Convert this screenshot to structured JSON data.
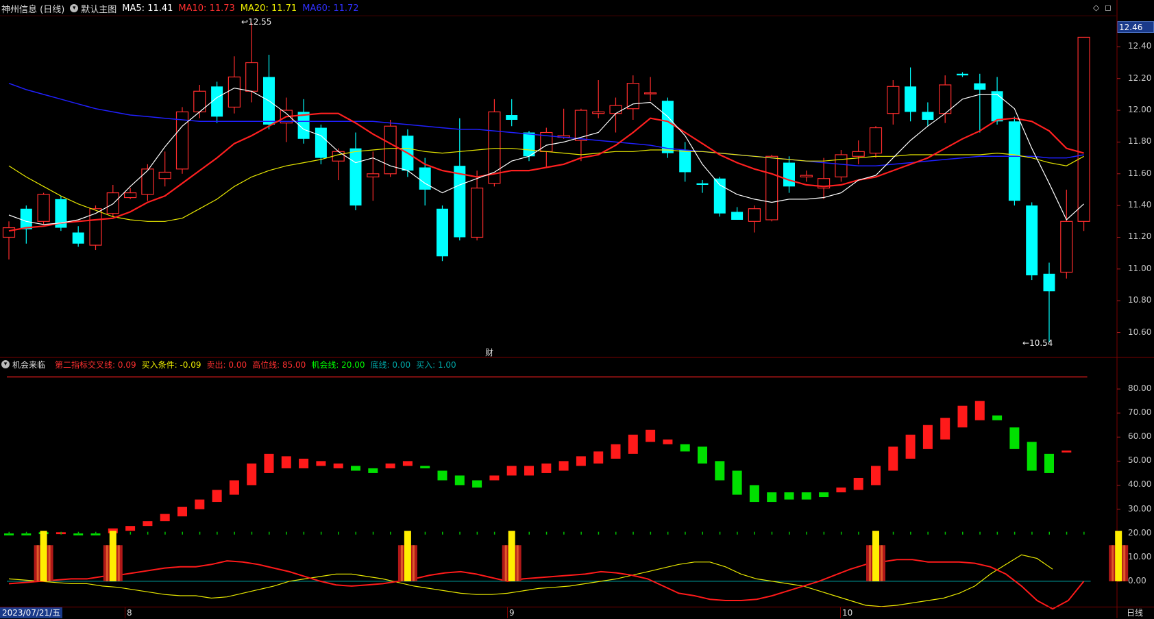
{
  "main_header": {
    "stock_label": "神州信息 (日线)",
    "main_chart_label": "默认主图",
    "ma5_label": "MA5: 11.41",
    "ma10_label": "MA10: 11.73",
    "ma20_label": "MA20: 11.71",
    "ma60_label": "MA60: 11.72",
    "colors": {
      "ma5": "#ffffff",
      "ma10": "#ff2020",
      "ma20": "#e8e800",
      "ma60": "#2020ff",
      "up": "#ff2d2d",
      "down": "#00ffff"
    }
  },
  "indicator_header": {
    "name": "机会来临",
    "cross_line": "第二指标交叉线: 0.09",
    "buy_condition": "买入条件: -0.09",
    "sell": "卖出: 0.00",
    "high_line": "高位线: 85.00",
    "chance_line": "机会线: 20.00",
    "bottom_line": "底线: 0.00",
    "buy": "买入: 1.00"
  },
  "price_axis": {
    "current_price": "12.46",
    "ticks": [
      "12.40",
      "12.20",
      "12.00",
      "11.80",
      "11.60",
      "11.40",
      "11.20",
      "11.00",
      "10.80",
      "10.60"
    ]
  },
  "indicator_axis": {
    "ticks": [
      "80.00",
      "70.00",
      "60.00",
      "50.00",
      "40.00",
      "30.00",
      "20.00",
      "10.00",
      "0.00"
    ]
  },
  "annotations": {
    "high_marker": "12.55",
    "low_marker": "10.54",
    "finance_icon": "财"
  },
  "date_axis": {
    "start_date": "2023/07/21/五",
    "month_labels": [
      "8",
      "9",
      "10"
    ],
    "period_label": "日线"
  },
  "chart_data": {
    "type": "candlestick",
    "ylim": [
      10.46,
      12.6
    ],
    "candles": [
      {
        "o": 11.2,
        "c": 11.26,
        "h": 11.3,
        "l": 11.06
      },
      {
        "o": 11.38,
        "c": 11.25,
        "h": 11.4,
        "l": 11.16
      },
      {
        "o": 11.3,
        "c": 11.47,
        "h": 11.48,
        "l": 11.28
      },
      {
        "o": 11.44,
        "c": 11.26,
        "h": 11.46,
        "l": 11.24
      },
      {
        "o": 11.23,
        "c": 11.16,
        "h": 11.27,
        "l": 11.14
      },
      {
        "o": 11.15,
        "c": 11.38,
        "h": 11.4,
        "l": 11.12
      },
      {
        "o": 11.35,
        "c": 11.48,
        "h": 11.53,
        "l": 11.33
      },
      {
        "o": 11.45,
        "c": 11.48,
        "h": 11.51,
        "l": 11.44
      },
      {
        "o": 11.47,
        "c": 11.63,
        "h": 11.66,
        "l": 11.43
      },
      {
        "o": 11.57,
        "c": 11.61,
        "h": 11.74,
        "l": 11.52
      },
      {
        "o": 11.63,
        "c": 11.99,
        "h": 12.02,
        "l": 11.6
      },
      {
        "o": 11.99,
        "c": 12.12,
        "h": 12.16,
        "l": 11.95
      },
      {
        "o": 12.15,
        "c": 11.96,
        "h": 12.18,
        "l": 11.92
      },
      {
        "o": 12.02,
        "c": 12.21,
        "h": 12.34,
        "l": 11.98
      },
      {
        "o": 12.12,
        "c": 12.3,
        "h": 12.55,
        "l": 12.05
      },
      {
        "o": 12.21,
        "c": 11.91,
        "h": 12.35,
        "l": 11.88
      },
      {
        "o": 11.92,
        "c": 12.0,
        "h": 12.08,
        "l": 11.8
      },
      {
        "o": 11.99,
        "c": 11.82,
        "h": 12.07,
        "l": 11.79
      },
      {
        "o": 11.89,
        "c": 11.7,
        "h": 11.91,
        "l": 11.66
      },
      {
        "o": 11.68,
        "c": 11.74,
        "h": 11.76,
        "l": 11.56
      },
      {
        "o": 11.76,
        "c": 11.4,
        "h": 11.86,
        "l": 11.37
      },
      {
        "o": 11.58,
        "c": 11.6,
        "h": 11.74,
        "l": 11.43
      },
      {
        "o": 11.6,
        "c": 11.9,
        "h": 11.94,
        "l": 11.58
      },
      {
        "o": 11.84,
        "c": 11.62,
        "h": 11.88,
        "l": 11.58
      },
      {
        "o": 11.64,
        "c": 11.5,
        "h": 11.7,
        "l": 11.4
      },
      {
        "o": 11.38,
        "c": 11.08,
        "h": 11.4,
        "l": 11.05
      },
      {
        "o": 11.65,
        "c": 11.2,
        "h": 11.95,
        "l": 11.18
      },
      {
        "o": 11.2,
        "c": 11.51,
        "h": 11.62,
        "l": 11.18
      },
      {
        "o": 11.54,
        "c": 11.99,
        "h": 12.07,
        "l": 11.52
      },
      {
        "o": 11.97,
        "c": 11.94,
        "h": 12.07,
        "l": 11.9
      },
      {
        "o": 11.86,
        "c": 11.71,
        "h": 11.87,
        "l": 11.68
      },
      {
        "o": 11.74,
        "c": 11.86,
        "h": 11.89,
        "l": 11.64
      },
      {
        "o": 11.83,
        "c": 11.84,
        "h": 12.01,
        "l": 11.82
      },
      {
        "o": 11.81,
        "c": 12.0,
        "h": 12.01,
        "l": 11.68
      },
      {
        "o": 11.98,
        "c": 11.99,
        "h": 12.19,
        "l": 11.95
      },
      {
        "o": 11.98,
        "c": 12.03,
        "h": 12.08,
        "l": 11.86
      },
      {
        "o": 12.01,
        "c": 12.17,
        "h": 12.22,
        "l": 11.94
      },
      {
        "o": 12.11,
        "c": 12.11,
        "h": 12.21,
        "l": 12.06
      },
      {
        "o": 12.06,
        "c": 11.73,
        "h": 12.08,
        "l": 11.7
      },
      {
        "o": 11.75,
        "c": 11.61,
        "h": 11.8,
        "l": 11.55
      },
      {
        "o": 11.54,
        "c": 11.53,
        "h": 11.56,
        "l": 11.48
      },
      {
        "o": 11.57,
        "c": 11.35,
        "h": 11.58,
        "l": 11.33
      },
      {
        "o": 11.36,
        "c": 11.31,
        "h": 11.39,
        "l": 11.31
      },
      {
        "o": 11.3,
        "c": 11.38,
        "h": 11.4,
        "l": 11.23
      },
      {
        "o": 11.31,
        "c": 11.71,
        "h": 11.72,
        "l": 11.3
      },
      {
        "o": 11.67,
        "c": 11.52,
        "h": 11.71,
        "l": 11.48
      },
      {
        "o": 11.58,
        "c": 11.59,
        "h": 11.62,
        "l": 11.55
      },
      {
        "o": 11.51,
        "c": 11.57,
        "h": 11.7,
        "l": 11.44
      },
      {
        "o": 11.58,
        "c": 11.72,
        "h": 11.75,
        "l": 11.55
      },
      {
        "o": 11.71,
        "c": 11.74,
        "h": 11.81,
        "l": 11.66
      },
      {
        "o": 11.73,
        "c": 11.89,
        "h": 11.9,
        "l": 11.7
      },
      {
        "o": 11.98,
        "c": 12.15,
        "h": 12.19,
        "l": 11.91
      },
      {
        "o": 12.15,
        "c": 11.99,
        "h": 12.27,
        "l": 11.93
      },
      {
        "o": 11.99,
        "c": 11.94,
        "h": 12.05,
        "l": 11.9
      },
      {
        "o": 11.98,
        "c": 12.16,
        "h": 12.22,
        "l": 11.92
      },
      {
        "o": 12.23,
        "c": 12.22,
        "h": 12.24,
        "l": 12.21
      },
      {
        "o": 12.17,
        "c": 12.13,
        "h": 12.23,
        "l": 11.86
      },
      {
        "o": 12.12,
        "c": 11.93,
        "h": 12.21,
        "l": 11.91
      },
      {
        "o": 11.93,
        "c": 11.43,
        "h": 11.96,
        "l": 11.4
      },
      {
        "o": 11.4,
        "c": 10.96,
        "h": 11.42,
        "l": 10.93
      },
      {
        "o": 10.97,
        "c": 10.86,
        "h": 11.04,
        "l": 10.54
      },
      {
        "o": 10.98,
        "c": 11.3,
        "h": 11.5,
        "l": 10.94
      },
      {
        "o": 11.3,
        "c": 12.46,
        "h": 12.46,
        "l": 11.24
      }
    ],
    "ma5": [
      11.34,
      11.3,
      11.28,
      11.29,
      11.31,
      11.35,
      11.41,
      11.52,
      11.62,
      11.77,
      11.9,
      11.99,
      12.08,
      12.14,
      12.12,
      12.06,
      11.98,
      11.88,
      11.84,
      11.74,
      11.67,
      11.7,
      11.65,
      11.62,
      11.54,
      11.48,
      11.53,
      11.57,
      11.61,
      11.68,
      11.71,
      11.78,
      11.8,
      11.83,
      11.86,
      11.98,
      12.04,
      12.05,
      11.96,
      11.84,
      11.66,
      11.53,
      11.47,
      11.44,
      11.42,
      11.44,
      11.44,
      11.45,
      11.48,
      11.56,
      11.59,
      11.7,
      11.81,
      11.9,
      11.98,
      12.07,
      12.1,
      12.1,
      12.01,
      11.76,
      11.54,
      11.31,
      11.41
    ],
    "ma10": [
      11.24,
      11.26,
      11.27,
      11.29,
      11.3,
      11.31,
      11.32,
      11.36,
      11.42,
      11.46,
      11.54,
      11.62,
      11.7,
      11.79,
      11.84,
      11.9,
      11.96,
      11.97,
      11.98,
      11.98,
      11.92,
      11.85,
      11.79,
      11.73,
      11.66,
      11.62,
      11.6,
      11.58,
      11.6,
      11.62,
      11.62,
      11.64,
      11.66,
      11.7,
      11.72,
      11.78,
      11.86,
      11.95,
      11.93,
      11.86,
      11.79,
      11.72,
      11.67,
      11.63,
      11.6,
      11.56,
      11.53,
      11.52,
      11.53,
      11.56,
      11.58,
      11.62,
      11.66,
      11.7,
      11.76,
      11.82,
      11.87,
      11.94,
      11.95,
      11.93,
      11.87,
      11.76,
      11.73
    ],
    "ma20": [
      11.65,
      11.58,
      11.52,
      11.46,
      11.41,
      11.37,
      11.33,
      11.31,
      11.3,
      11.3,
      11.32,
      11.38,
      11.44,
      11.52,
      11.58,
      11.62,
      11.65,
      11.67,
      11.69,
      11.72,
      11.74,
      11.75,
      11.76,
      11.76,
      11.74,
      11.73,
      11.74,
      11.75,
      11.76,
      11.76,
      11.75,
      11.74,
      11.73,
      11.72,
      11.73,
      11.74,
      11.74,
      11.75,
      11.75,
      11.74,
      11.74,
      11.73,
      11.72,
      11.71,
      11.7,
      11.69,
      11.68,
      11.68,
      11.69,
      11.7,
      11.71,
      11.71,
      11.72,
      11.72,
      11.72,
      11.72,
      11.72,
      11.73,
      11.72,
      11.7,
      11.67,
      11.65,
      11.71
    ],
    "ma60": [
      12.17,
      12.13,
      12.1,
      12.07,
      12.04,
      12.01,
      11.99,
      11.97,
      11.96,
      11.95,
      11.94,
      11.93,
      11.93,
      11.93,
      11.93,
      11.93,
      11.93,
      11.93,
      11.93,
      11.93,
      11.93,
      11.93,
      11.92,
      11.91,
      11.9,
      11.89,
      11.88,
      11.88,
      11.87,
      11.86,
      11.85,
      11.84,
      11.83,
      11.82,
      11.81,
      11.8,
      11.79,
      11.78,
      11.76,
      11.75,
      11.74,
      11.73,
      11.72,
      11.71,
      11.7,
      11.69,
      11.68,
      11.67,
      11.66,
      11.65,
      11.65,
      11.66,
      11.67,
      11.68,
      11.69,
      11.7,
      11.71,
      11.71,
      11.71,
      11.71,
      11.7,
      11.7,
      11.72
    ],
    "indicator": {
      "ylim": [
        -10,
        88
      ],
      "high_line": 85,
      "chance_line": 20,
      "bottom_line": 0,
      "bars": [
        {
          "v": 19.5,
          "c": "green"
        },
        {
          "v": 19.5,
          "c": "green"
        },
        {
          "v": 20,
          "c": "green"
        },
        {
          "v": 20,
          "c": "red"
        },
        {
          "v": 19.5,
          "c": "green"
        },
        {
          "v": 19.5,
          "c": "green"
        },
        {
          "v": 21,
          "c": "red"
        },
        {
          "v": 22,
          "c": "red"
        },
        {
          "v": 24,
          "c": "red"
        },
        {
          "v": 26,
          "c": "red"
        },
        {
          "v": 29,
          "c": "red"
        },
        {
          "v": 32,
          "c": "red"
        },
        {
          "v": 35,
          "c": "red"
        },
        {
          "v": 39,
          "c": "red"
        },
        {
          "v": 45,
          "c": "red"
        },
        {
          "v": 49,
          "c": "red"
        },
        {
          "v": 50,
          "c": "red"
        },
        {
          "v": 50,
          "c": "red"
        },
        {
          "v": 49,
          "c": "red"
        },
        {
          "v": 48,
          "c": "red"
        },
        {
          "v": 47,
          "c": "green"
        },
        {
          "v": 46,
          "c": "green"
        },
        {
          "v": 48,
          "c": "red"
        },
        {
          "v": 49,
          "c": "red"
        },
        {
          "v": 48,
          "c": "green"
        },
        {
          "v": 44,
          "c": "green"
        },
        {
          "v": 42,
          "c": "green"
        },
        {
          "v": 41,
          "c": "green"
        },
        {
          "v": 43,
          "c": "red"
        },
        {
          "v": 46,
          "c": "red"
        },
        {
          "v": 46,
          "c": "red"
        },
        {
          "v": 47,
          "c": "red"
        },
        {
          "v": 48,
          "c": "red"
        },
        {
          "v": 50,
          "c": "red"
        },
        {
          "v": 52,
          "c": "red"
        },
        {
          "v": 54,
          "c": "red"
        },
        {
          "v": 57,
          "c": "red"
        },
        {
          "v": 60,
          "c": "red"
        },
        {
          "v": 58,
          "c": "red"
        },
        {
          "v": 56,
          "c": "green"
        },
        {
          "v": 53,
          "c": "green"
        },
        {
          "v": 49,
          "c": "green"
        },
        {
          "v": 43,
          "c": "green"
        },
        {
          "v": 37,
          "c": "green"
        },
        {
          "v": 34,
          "c": "green"
        },
        {
          "v": 35,
          "c": "green"
        },
        {
          "v": 35,
          "c": "green"
        },
        {
          "v": 36,
          "c": "green"
        },
        {
          "v": 38,
          "c": "red"
        },
        {
          "v": 41,
          "c": "red"
        },
        {
          "v": 45,
          "c": "red"
        },
        {
          "v": 51,
          "c": "red"
        },
        {
          "v": 56,
          "c": "red"
        },
        {
          "v": 60,
          "c": "red"
        },
        {
          "v": 65,
          "c": "red"
        },
        {
          "v": 69,
          "c": "red"
        },
        {
          "v": 71,
          "c": "red"
        },
        {
          "v": 67,
          "c": "green"
        },
        {
          "v": 60,
          "c": "green"
        },
        {
          "v": 52,
          "c": "green"
        },
        {
          "v": 49,
          "c": "green"
        },
        {
          "v": 54,
          "c": "red"
        }
      ],
      "bar_ranges": [
        [
          0,
          0
        ],
        [
          0,
          0
        ],
        [
          0,
          0
        ],
        [
          0,
          0
        ],
        [
          0,
          0
        ],
        [
          0,
          0
        ],
        [
          20,
          22
        ],
        [
          21,
          23
        ],
        [
          23,
          25
        ],
        [
          25,
          28
        ],
        [
          27,
          31
        ],
        [
          30,
          34
        ],
        [
          33,
          38
        ],
        [
          36,
          42
        ],
        [
          40,
          49
        ],
        [
          45,
          53
        ],
        [
          47,
          52
        ],
        [
          47,
          51
        ],
        [
          48,
          50
        ],
        [
          47,
          49
        ],
        [
          46,
          48
        ],
        [
          45,
          47
        ],
        [
          47,
          49
        ],
        [
          48,
          50
        ],
        [
          47,
          48
        ],
        [
          42,
          46
        ],
        [
          40,
          44
        ],
        [
          39,
          42
        ],
        [
          42,
          44
        ],
        [
          44,
          48
        ],
        [
          44,
          48
        ],
        [
          45,
          49
        ],
        [
          46,
          50
        ],
        [
          48,
          52
        ],
        [
          49,
          54
        ],
        [
          51,
          57
        ],
        [
          53,
          61
        ],
        [
          58,
          63
        ],
        [
          57,
          59
        ],
        [
          54,
          57
        ],
        [
          49,
          56
        ],
        [
          42,
          50
        ],
        [
          36,
          46
        ],
        [
          33,
          40
        ],
        [
          33,
          37
        ],
        [
          34,
          37
        ],
        [
          34,
          37
        ],
        [
          35,
          37
        ],
        [
          37,
          39
        ],
        [
          38,
          43
        ],
        [
          40,
          48
        ],
        [
          46,
          56
        ],
        [
          51,
          61
        ],
        [
          55,
          65
        ],
        [
          59,
          68
        ],
        [
          64,
          73
        ],
        [
          67,
          75
        ],
        [
          67,
          69
        ],
        [
          55,
          64
        ],
        [
          46,
          58
        ],
        [
          45,
          53
        ],
        [
          54,
          54
        ]
      ],
      "red_line": [
        -1,
        -0.5,
        0,
        0.5,
        1,
        1,
        2,
        2.5,
        3.5,
        4.5,
        5.5,
        6,
        6,
        7,
        8.5,
        8,
        7,
        5.5,
        4,
        2,
        0,
        -1.5,
        -2,
        -1.5,
        -1,
        0,
        1,
        2.5,
        3.5,
        4,
        3,
        1.5,
        0,
        1,
        1.5,
        2,
        2.5,
        3,
        4,
        3.5,
        2.5,
        1,
        -2,
        -5,
        -6,
        -7.5,
        -8,
        -8,
        -7.5,
        -6,
        -4,
        -2,
        0,
        2.5,
        5,
        7,
        8,
        9,
        9,
        8,
        8,
        8,
        7.5,
        6,
        3,
        -2,
        -8,
        -11.5,
        -8,
        0
      ],
      "yellow_line": [
        1,
        0.5,
        0,
        -0.5,
        -1,
        -1,
        -2,
        -2.5,
        -3.5,
        -4.5,
        -5.5,
        -6,
        -6,
        -7,
        -6.5,
        -5,
        -3.5,
        -2,
        0,
        1,
        2,
        3,
        3,
        2,
        1,
        -0.5,
        -2,
        -3,
        -4,
        -5,
        -5.5,
        -5.5,
        -5,
        -4,
        -3,
        -2.5,
        -2,
        -1,
        0,
        1,
        2.5,
        4,
        5.5,
        7,
        8,
        8,
        6,
        3,
        1,
        0,
        -1,
        -2,
        -4,
        -6,
        -8,
        -10,
        -10.5,
        -10,
        -9,
        -8,
        -7,
        -5,
        -2,
        3,
        7,
        11,
        9.5,
        5
      ],
      "buy_signals": [
        2,
        6,
        23,
        29,
        50,
        64
      ]
    }
  }
}
